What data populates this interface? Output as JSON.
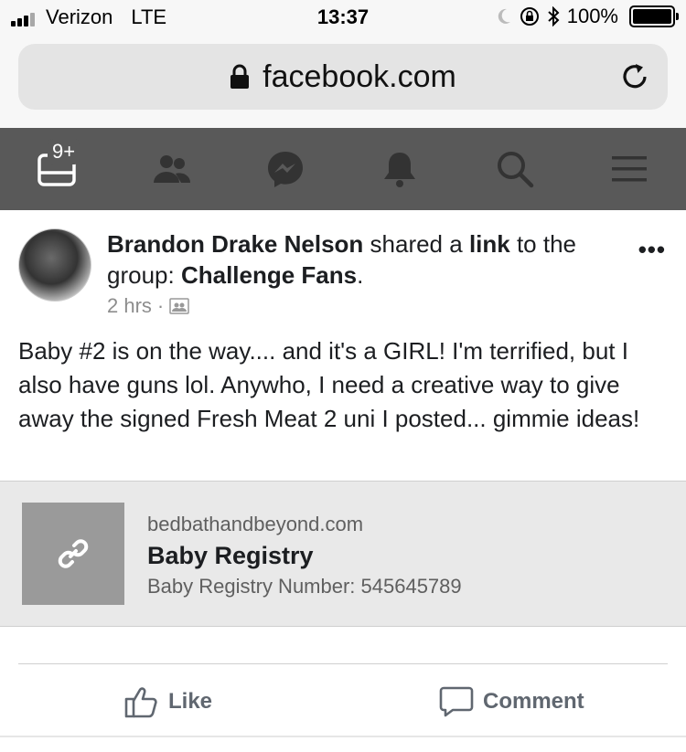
{
  "status_bar": {
    "carrier": "Verizon",
    "network": "LTE",
    "time": "13:37",
    "battery": "100%"
  },
  "browser": {
    "url": "facebook.com"
  },
  "nav": {
    "notification_badge": "9+",
    "icons": [
      "feed-icon",
      "friends-icon",
      "messenger-icon",
      "notifications-icon",
      "search-icon",
      "menu-icon"
    ]
  },
  "post": {
    "author": "Brandon Drake Nelson",
    "action_text": " shared a ",
    "link_word": "link",
    "to_the": " to the",
    "group_prefix": "group: ",
    "group_name": "Challenge Fans",
    "group_suffix": ".",
    "time": "2 hrs",
    "separator": "·",
    "more": "•••",
    "body": "Baby #2 is on the way.... and it's a GIRL! I'm terrified, but I also have guns lol. Anywho, I need a creative way to give away the signed Fresh Meat 2 uni I posted... gimmie ideas!"
  },
  "link_card": {
    "domain": "bedbathandbeyond.com",
    "title": "Baby Registry",
    "description": "Baby Registry Number: 545645789"
  },
  "actions": {
    "like": "Like",
    "comment": "Comment"
  },
  "colors": {
    "nav_bg": "#595959",
    "card_bg": "#e9e9e9",
    "muted_text": "#606770"
  }
}
